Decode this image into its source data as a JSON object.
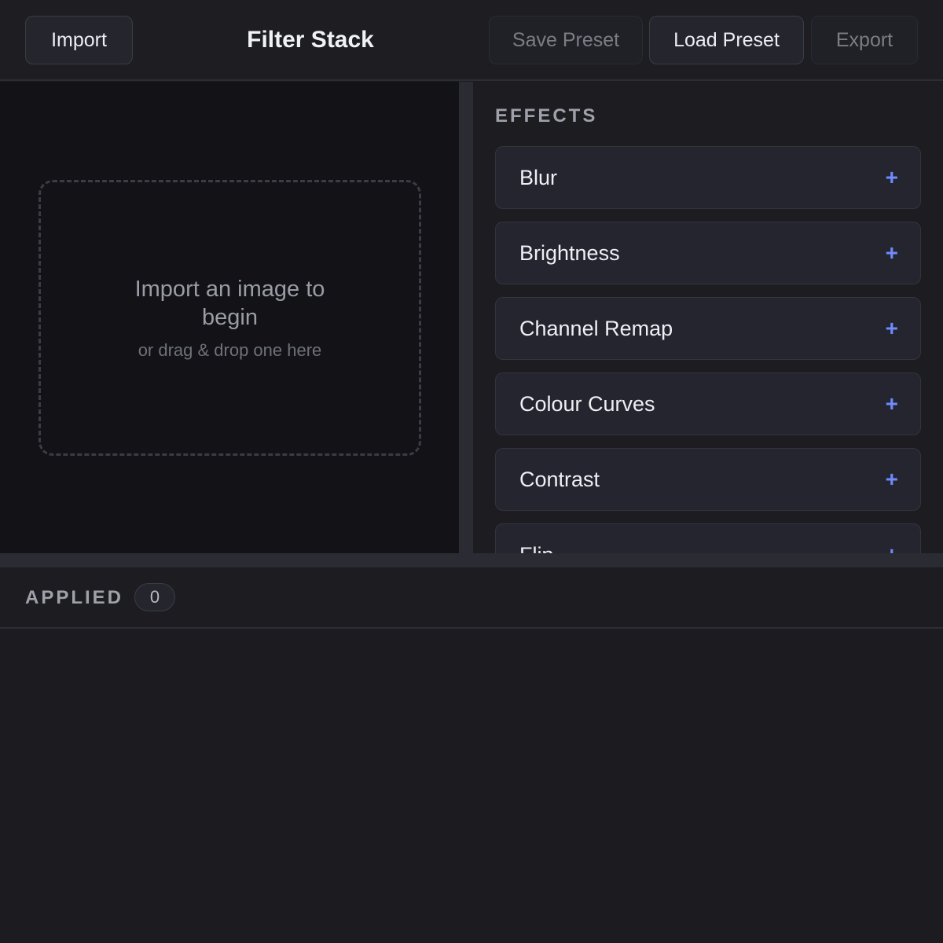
{
  "toolbar": {
    "import_label": "Import",
    "title": "Filter Stack",
    "save_preset_label": "Save Preset",
    "load_preset_label": "Load Preset",
    "export_label": "Export"
  },
  "preview": {
    "prompt": "Import an image to begin",
    "hint": "or drag & drop one here"
  },
  "effects": {
    "heading": "EFFECTS",
    "items": [
      {
        "label": "Blur",
        "icon": "plus-icon"
      },
      {
        "label": "Brightness",
        "icon": "plus-icon"
      },
      {
        "label": "Channel Remap",
        "icon": "plus-icon"
      },
      {
        "label": "Colour Curves",
        "icon": "plus-icon"
      },
      {
        "label": "Contrast",
        "icon": "plus-icon"
      },
      {
        "label": "Flip",
        "icon": "plus-icon"
      }
    ],
    "add_glyph": "+"
  },
  "applied": {
    "heading": "APPLIED",
    "count": "0"
  },
  "colors": {
    "accent": "#6f8bff",
    "background": "#1b1b20",
    "preview_bg": "#121217"
  }
}
